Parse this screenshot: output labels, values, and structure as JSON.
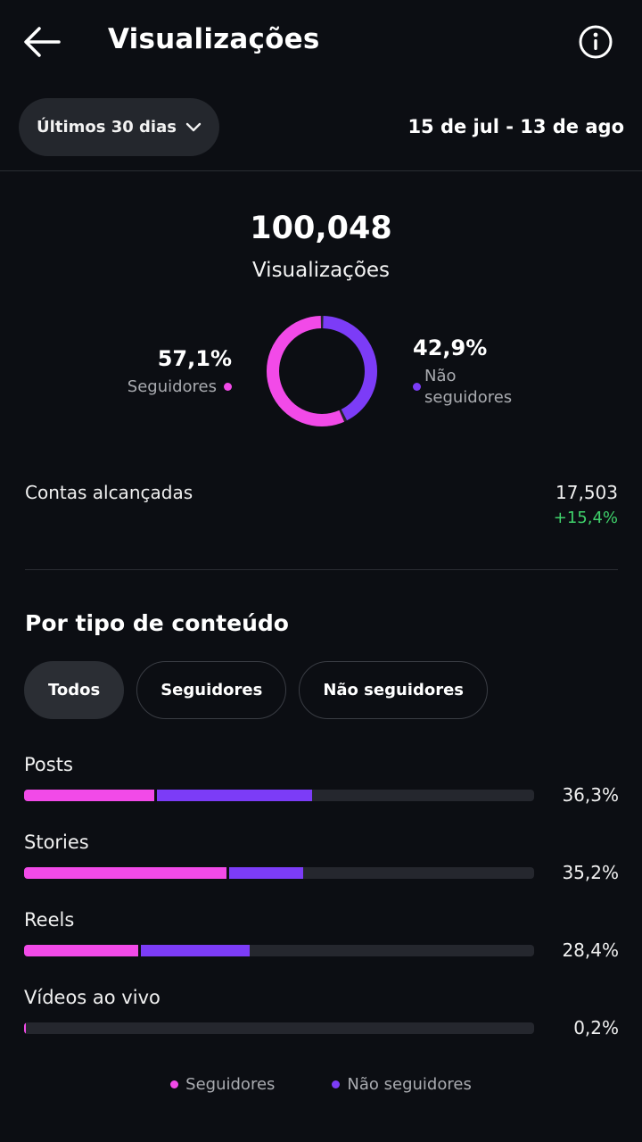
{
  "header": {
    "title": "Visualizações"
  },
  "period": {
    "label": "Últimos 30 dias",
    "date_range": "15 de jul - 13 de ago"
  },
  "summary": {
    "total": "100,048",
    "label": "Visualizações",
    "followers_pct": "57,1%",
    "followers_label": "Seguidores",
    "followers_fraction": 0.571,
    "non_followers_pct": "42,9%",
    "non_followers_label": "Não seguidores",
    "non_followers_label_line1": "Não",
    "non_followers_label_line2": "seguidores"
  },
  "reach": {
    "label": "Contas alcançadas",
    "value": "17,503",
    "change": "+15,4%"
  },
  "content_type": {
    "title": "Por tipo de conteúdo",
    "tabs": [
      {
        "label": "Todos",
        "active": true
      },
      {
        "label": "Seguidores",
        "active": false
      },
      {
        "label": "Não seguidores",
        "active": false
      }
    ],
    "rows": [
      {
        "label": "Posts",
        "pct": "36,3%",
        "followers": 16.6,
        "non_followers": 19.7
      },
      {
        "label": "Stories",
        "pct": "35,2%",
        "followers": 25.8,
        "non_followers": 9.4
      },
      {
        "label": "Reels",
        "pct": "28,4%",
        "followers": 14.5,
        "non_followers": 13.9
      },
      {
        "label": "Vídeos ao vivo",
        "pct": "0,2%",
        "followers": 0.2,
        "non_followers": 0
      }
    ],
    "legend": {
      "followers": "Seguidores",
      "non_followers": "Não seguidores"
    }
  },
  "colors": {
    "followers": "#f24ae8",
    "non_followers": "#7c3cf7",
    "positive": "#3fd16b",
    "background": "#0c0e13"
  },
  "icons": {
    "back": "arrow-left-icon",
    "info": "info-icon",
    "dropdown": "chevron-down-icon"
  }
}
